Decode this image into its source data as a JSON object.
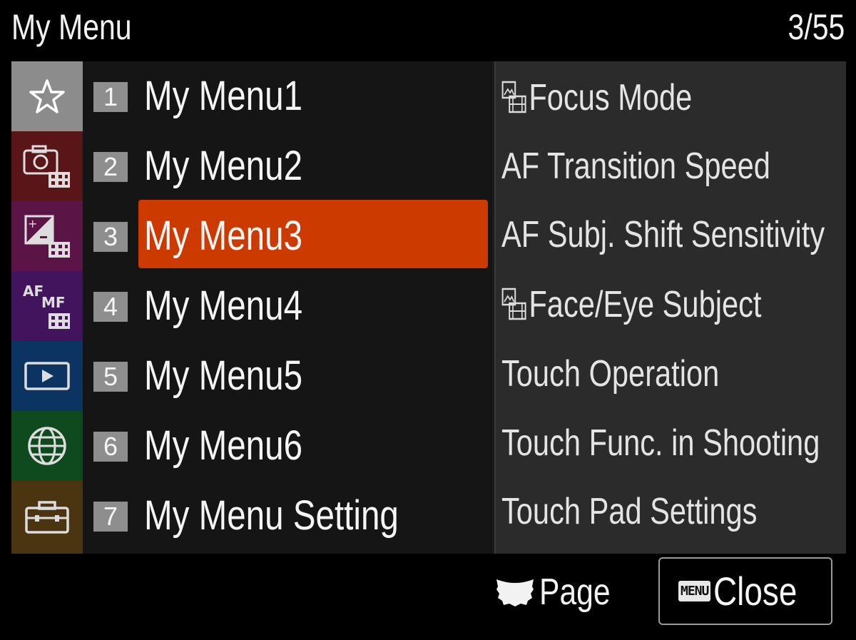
{
  "header": {
    "title": "My Menu",
    "page_counter": "3/55"
  },
  "tabs": [
    {
      "icon": "star-icon",
      "color": "#8c8c8c"
    },
    {
      "icon": "camera-movie-icon",
      "color": "#5a1518"
    },
    {
      "icon": "exposure-movie-icon",
      "color": "#5a1546"
    },
    {
      "icon": "af-mf-movie-icon",
      "color": "#42145e"
    },
    {
      "icon": "playback-icon",
      "color": "#0c3462"
    },
    {
      "icon": "network-globe-icon",
      "color": "#0f4a1e"
    },
    {
      "icon": "toolbox-icon",
      "color": "#4a3510"
    }
  ],
  "menu": {
    "selected_index": 2,
    "highlight_color": "#cc3a00",
    "items": [
      {
        "num": "1",
        "label": "My Menu1"
      },
      {
        "num": "2",
        "label": "My Menu2"
      },
      {
        "num": "3",
        "label": "My Menu3"
      },
      {
        "num": "4",
        "label": "My Menu4"
      },
      {
        "num": "5",
        "label": "My Menu5"
      },
      {
        "num": "6",
        "label": "My Menu6"
      },
      {
        "num": "7",
        "label": "My Menu Setting"
      }
    ]
  },
  "submenu": {
    "items": [
      {
        "label": "Focus Mode",
        "icon": "movie-mode-icon"
      },
      {
        "label": "AF Transition Speed"
      },
      {
        "label": "AF Subj. Shift Sensitivity"
      },
      {
        "label": "Face/Eye Subject",
        "icon": "movie-mode-icon"
      },
      {
        "label": "Touch Operation"
      },
      {
        "label": "Touch Func. in Shooting"
      },
      {
        "label": "Touch Pad Settings"
      }
    ]
  },
  "footer": {
    "page_label": "Page",
    "page_icon": "control-wheel-icon",
    "close_badge": "MENU",
    "close_label": "Close"
  }
}
